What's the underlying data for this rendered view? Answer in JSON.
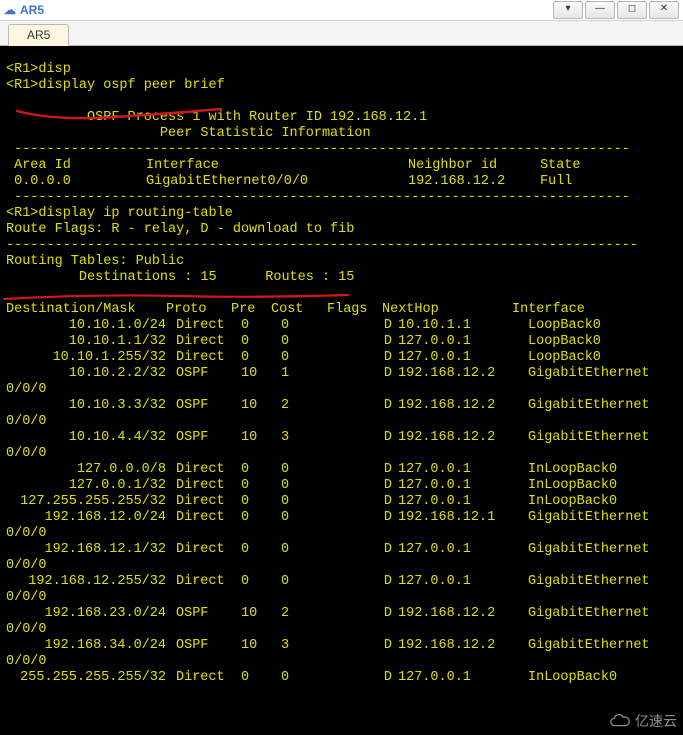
{
  "window": {
    "title": "AR5"
  },
  "tab": {
    "label": "AR5"
  },
  "lines": {
    "disp_fragment": "<R1>disp",
    "cmd_ospf": "<R1>display ospf peer brief",
    "ospf_header": "\t  OSPF Process 1 with Router ID 192.168.12.1",
    "ospf_sub": "\t\t   Peer Statistic Information",
    "rule_dash": " ----------------------------------------------------------------------------",
    "ospf_cols": {
      "area": " Area Id",
      "intf": "Interface",
      "nbr": "Neighbor id",
      "state": "State"
    },
    "ospf_row": {
      "area": " 0.0.0.0",
      "intf": "GigabitEthernet0/0/0",
      "nbr": "192.168.12.2",
      "state": "Full"
    },
    "cmd_route": "<R1>display ip routing-table",
    "route_flags": "Route Flags: R - relay, D - download to fib",
    "rule_long": "------------------------------------------------------------------------------",
    "tables_public": "Routing Tables: Public",
    "dest_routes": "         Destinations : 15\tRoutes : 15",
    "cols": {
      "dest": "Destination/Mask",
      "proto": "Proto",
      "pre": "Pre",
      "cost": "Cost",
      "flags": "Flags",
      "nexthop": "NextHop",
      "intf": "Interface"
    }
  },
  "routes": [
    {
      "dest": "10.10.1.0/24",
      "proto": "Direct",
      "pre": "0",
      "cost": "0",
      "flags": "D",
      "nexthop": "10.10.1.1",
      "intf": "LoopBack0",
      "wrap": false
    },
    {
      "dest": "10.10.1.1/32",
      "proto": "Direct",
      "pre": "0",
      "cost": "0",
      "flags": "D",
      "nexthop": "127.0.0.1",
      "intf": "LoopBack0",
      "wrap": false
    },
    {
      "dest": "10.10.1.255/32",
      "proto": "Direct",
      "pre": "0",
      "cost": "0",
      "flags": "D",
      "nexthop": "127.0.0.1",
      "intf": "LoopBack0",
      "wrap": false
    },
    {
      "dest": "10.10.2.2/32",
      "proto": "OSPF",
      "pre": "10",
      "cost": "1",
      "flags": "D",
      "nexthop": "192.168.12.2",
      "intf": "GigabitEthernet",
      "wrap": true
    },
    {
      "dest": "10.10.3.3/32",
      "proto": "OSPF",
      "pre": "10",
      "cost": "2",
      "flags": "D",
      "nexthop": "192.168.12.2",
      "intf": "GigabitEthernet",
      "wrap": true
    },
    {
      "dest": "10.10.4.4/32",
      "proto": "OSPF",
      "pre": "10",
      "cost": "3",
      "flags": "D",
      "nexthop": "192.168.12.2",
      "intf": "GigabitEthernet",
      "wrap": true
    },
    {
      "dest": "127.0.0.0/8",
      "proto": "Direct",
      "pre": "0",
      "cost": "0",
      "flags": "D",
      "nexthop": "127.0.0.1",
      "intf": "InLoopBack0",
      "wrap": false
    },
    {
      "dest": "127.0.0.1/32",
      "proto": "Direct",
      "pre": "0",
      "cost": "0",
      "flags": "D",
      "nexthop": "127.0.0.1",
      "intf": "InLoopBack0",
      "wrap": false
    },
    {
      "dest": "127.255.255.255/32",
      "proto": "Direct",
      "pre": "0",
      "cost": "0",
      "flags": "D",
      "nexthop": "127.0.0.1",
      "intf": "InLoopBack0",
      "wrap": false
    },
    {
      "dest": "192.168.12.0/24",
      "proto": "Direct",
      "pre": "0",
      "cost": "0",
      "flags": "D",
      "nexthop": "192.168.12.1",
      "intf": "GigabitEthernet",
      "wrap": true
    },
    {
      "dest": "192.168.12.1/32",
      "proto": "Direct",
      "pre": "0",
      "cost": "0",
      "flags": "D",
      "nexthop": "127.0.0.1",
      "intf": "GigabitEthernet",
      "wrap": true
    },
    {
      "dest": "192.168.12.255/32",
      "proto": "Direct",
      "pre": "0",
      "cost": "0",
      "flags": "D",
      "nexthop": "127.0.0.1",
      "intf": "GigabitEthernet",
      "wrap": true
    },
    {
      "dest": "192.168.23.0/24",
      "proto": "OSPF",
      "pre": "10",
      "cost": "2",
      "flags": "D",
      "nexthop": "192.168.12.2",
      "intf": "GigabitEthernet",
      "wrap": true
    },
    {
      "dest": "192.168.34.0/24",
      "proto": "OSPF",
      "pre": "10",
      "cost": "3",
      "flags": "D",
      "nexthop": "192.168.12.2",
      "intf": "GigabitEthernet",
      "wrap": true
    },
    {
      "dest": "255.255.255.255/32",
      "proto": "Direct",
      "pre": "0",
      "cost": "0",
      "flags": "D",
      "nexthop": "127.0.0.1",
      "intf": "InLoopBack0",
      "wrap": false
    }
  ],
  "wrap_suffix": "0/0/0",
  "watermark": "亿速云"
}
